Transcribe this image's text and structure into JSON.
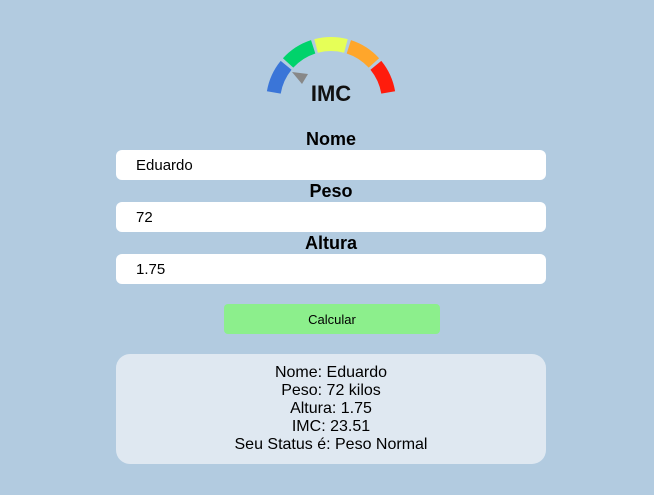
{
  "logo": {
    "title": "IMC",
    "segment_colors": [
      "#3a75d8",
      "#00d36b",
      "#e6ff57",
      "#ffa62b",
      "#ff1c0c"
    ],
    "pointer_color": "#888888"
  },
  "form": {
    "nome": {
      "label": "Nome",
      "value": "Eduardo"
    },
    "peso": {
      "label": "Peso",
      "value": "72"
    },
    "altura": {
      "label": "Altura",
      "value": "1.75"
    }
  },
  "button": {
    "label": "Calcular",
    "color": "#8cef8c"
  },
  "result": {
    "lines": [
      "Nome: Eduardo",
      "Peso: 72 kilos",
      "Altura: 1.75",
      "IMC: 23.51",
      "Seu Status é: Peso Normal"
    ]
  }
}
